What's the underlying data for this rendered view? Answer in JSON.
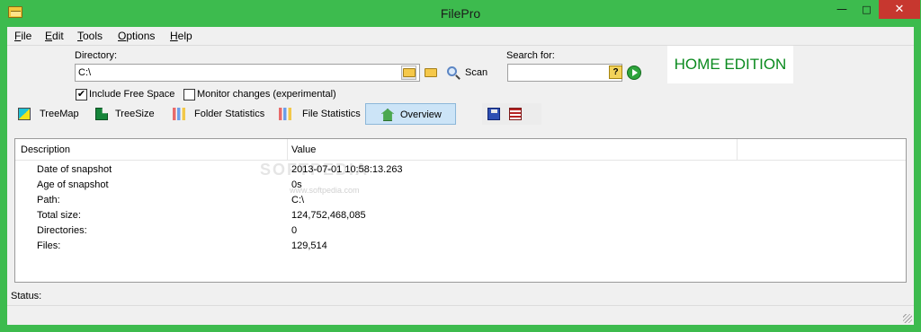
{
  "window": {
    "title": "FilePro",
    "minimize_glyph": "—",
    "maximize_glyph": "□",
    "close_glyph": "✕"
  },
  "menu": {
    "items": [
      {
        "label_first": "F",
        "label_rest": "ile"
      },
      {
        "label_first": "E",
        "label_rest": "dit"
      },
      {
        "label_first": "T",
        "label_rest": "ools"
      },
      {
        "label_first": "O",
        "label_rest": "ptions"
      },
      {
        "label_first": "H",
        "label_rest": "elp"
      }
    ]
  },
  "toolbar": {
    "directory_label": "Directory:",
    "directory_value": "C:\\",
    "scan_label": "Scan",
    "search_label": "Search for:",
    "search_value": "",
    "search_help_glyph": "?",
    "edition": "HOME EDITION",
    "include_free_space_label": "Include Free Space",
    "include_free_space_checked": true,
    "include_free_space_mark": "✔",
    "monitor_changes_label": "Monitor changes (experimental)",
    "monitor_changes_checked": false,
    "monitor_changes_mark": ""
  },
  "views": [
    {
      "label": "TreeMap",
      "icon": "treemap-icon",
      "active": false
    },
    {
      "label": "TreeSize",
      "icon": "treesize-icon",
      "active": false
    },
    {
      "label": "Folder Statistics",
      "icon": "folder-statistics-icon",
      "active": false
    },
    {
      "label": "File Statistics",
      "icon": "file-statistics-icon",
      "active": false
    },
    {
      "label": "Overview",
      "icon": "overview-icon",
      "active": true
    }
  ],
  "actions": [
    {
      "icon": "save-icon"
    },
    {
      "icon": "export-list-icon"
    }
  ],
  "grid": {
    "columns": [
      "Description",
      "Value"
    ],
    "rows": [
      {
        "description": "Date of snapshot",
        "value": "2013-07-01 10:58:13.263"
      },
      {
        "description": "Age of snapshot",
        "value": "0s"
      },
      {
        "description": "Path:",
        "value": "C:\\"
      },
      {
        "description": "Total size:",
        "value": "124,752,468,085"
      },
      {
        "description": "Directories:",
        "value": "0"
      },
      {
        "description": "Files:",
        "value": "129,514"
      }
    ],
    "watermark": "SOFTPEDIA",
    "watermark_url": "www.softpedia.com"
  },
  "status": {
    "label": "Status:"
  },
  "colors": {
    "frame": "#3dbb4e",
    "edition_text": "#0a8a1e",
    "active_view_bg": "#cce4f7",
    "close_button": "#c7372f"
  }
}
